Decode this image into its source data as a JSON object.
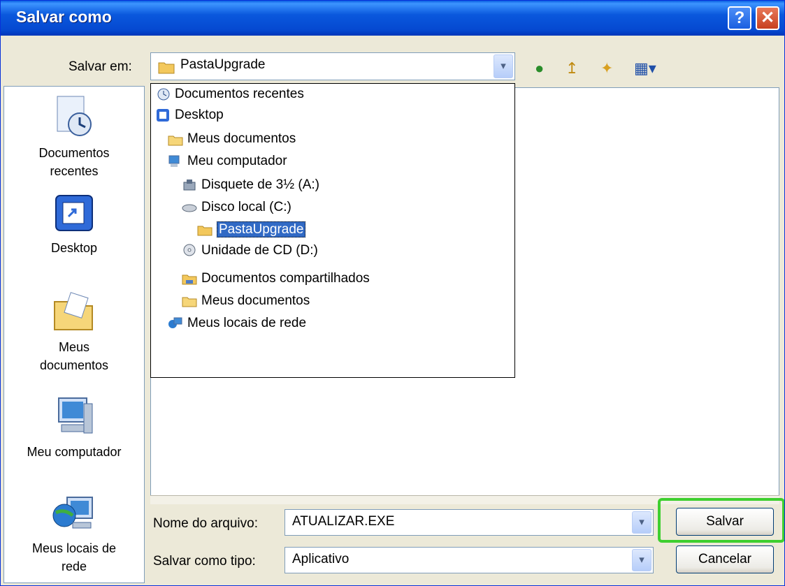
{
  "window": {
    "title": "Salvar como"
  },
  "titlebar": {
    "help_glyph": "?",
    "close_glyph": "✕"
  },
  "save_in": {
    "label": "Salvar em:",
    "value": "PastaUpgrade"
  },
  "toolbar": {
    "back_glyph": "●",
    "up_glyph": "↥",
    "newfolder_glyph": "✦",
    "views_glyph": "▦▾"
  },
  "places": [
    {
      "label_1": "Documentos",
      "label_2": "recentes"
    },
    {
      "label_1": "Desktop",
      "label_2": ""
    },
    {
      "label_1": "Meus",
      "label_2": "documentos"
    },
    {
      "label_1": "Meu computador",
      "label_2": ""
    },
    {
      "label_1": "Meus locais de",
      "label_2": "rede"
    }
  ],
  "location_list": [
    "Documentos recentes",
    "Desktop",
    "Meus documentos",
    "Meu computador",
    "Disquete de 3½ (A:)",
    "Disco local (C:)",
    "PastaUpgrade",
    "Unidade de CD (D:)",
    "Documentos compartilhados",
    "Meus documentos",
    "Meus locais de rede"
  ],
  "filename": {
    "label": "Nome do arquivo:",
    "value": "ATUALIZAR.EXE"
  },
  "filetype": {
    "label": "Salvar como tipo:",
    "value": "Aplicativo"
  },
  "buttons": {
    "save": "Salvar",
    "cancel": "Cancelar"
  },
  "colors": {
    "titlebar": "#0548d0",
    "highlight": "#3ecf2f",
    "selection": "#316ac5"
  }
}
